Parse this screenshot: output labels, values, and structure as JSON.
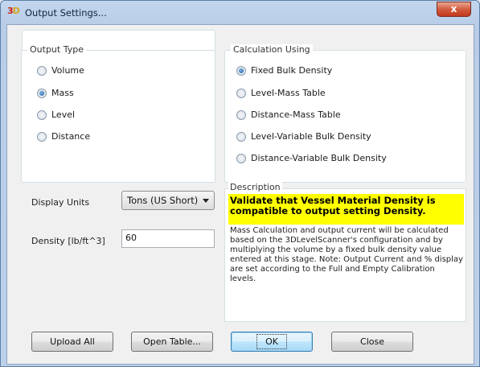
{
  "window": {
    "title": "Output Settings...",
    "app_icon": "3D-level-scanner-icon",
    "close_label": "x"
  },
  "output_type": {
    "title": "Output Type",
    "options": [
      {
        "label": "Volume",
        "checked": false
      },
      {
        "label": "Mass",
        "checked": true
      },
      {
        "label": "Level",
        "checked": false
      },
      {
        "label": "Distance",
        "checked": false
      }
    ]
  },
  "calculation": {
    "title": "Calculation Using",
    "options": [
      {
        "label": "Fixed Bulk Density",
        "checked": true
      },
      {
        "label": "Level-Mass Table",
        "checked": false
      },
      {
        "label": "Distance-Mass Table",
        "checked": false
      },
      {
        "label": "Level-Variable Bulk Density",
        "checked": false
      },
      {
        "label": "Distance-Variable Bulk Density",
        "checked": false
      }
    ]
  },
  "display_units": {
    "label": "Display Units",
    "value": "Tons (US Short)"
  },
  "density": {
    "label": "Density [lb/ft^3]",
    "value": "60"
  },
  "description": {
    "title": "Description",
    "warning": "Validate that Vessel Material Density is compatible to output setting Density.",
    "body": "Mass Calculation and output current will be calculated based on the 3DLevelScanner's configuration and by multiplying the volume by a fixed bulk density value entered at this stage. Note: Output Current and % display are set according to the Full and Empty Calibration levels.",
    "highlight_color": "#ffff00"
  },
  "buttons": {
    "upload_all": "Upload All",
    "open_table": "Open Table...",
    "ok": "OK",
    "close": "Close"
  }
}
